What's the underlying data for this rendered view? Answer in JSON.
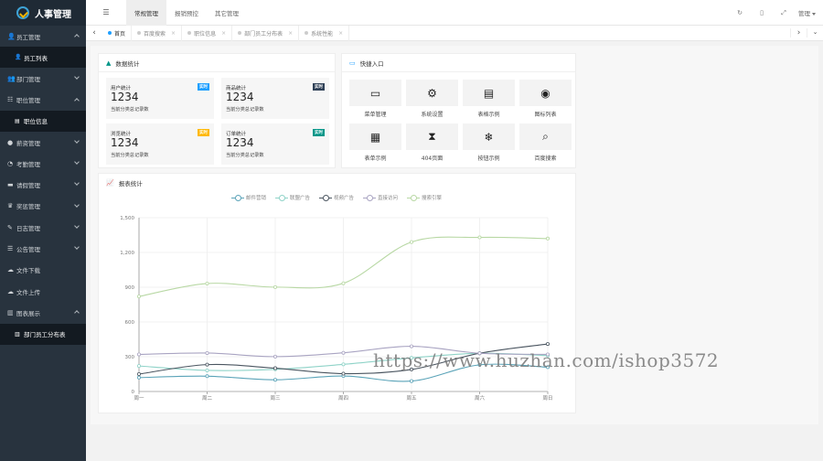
{
  "app": {
    "title": "人事管理"
  },
  "sidebar": {
    "items": [
      {
        "label": "员工管理",
        "icon": "user-icon",
        "glyph": "👤",
        "expanded": true,
        "children": [
          {
            "label": "员工列表",
            "glyph": "👤"
          }
        ]
      },
      {
        "label": "部门管理",
        "icon": "users-icon",
        "glyph": "👥",
        "expanded": false
      },
      {
        "label": "职位管理",
        "icon": "list-icon",
        "glyph": "☷",
        "expanded": true,
        "children": [
          {
            "label": "职位信息",
            "glyph": "▤"
          }
        ]
      },
      {
        "label": "薪资管理",
        "icon": "money-icon",
        "glyph": "●",
        "expanded": false
      },
      {
        "label": "考勤管理",
        "icon": "clock-icon",
        "glyph": "◔",
        "expanded": false
      },
      {
        "label": "请假管理",
        "icon": "bed-icon",
        "glyph": "▬",
        "expanded": false
      },
      {
        "label": "奖惩管理",
        "icon": "trophy-icon",
        "glyph": "♛",
        "expanded": false
      },
      {
        "label": "日志管理",
        "icon": "wrench-icon",
        "glyph": "✎",
        "expanded": false
      },
      {
        "label": "公告管理",
        "icon": "bars-icon",
        "glyph": "☰",
        "expanded": false
      },
      {
        "label": "文件下载",
        "icon": "cloud-download-icon",
        "glyph": "☁",
        "expanded": null
      },
      {
        "label": "文件上传",
        "icon": "cloud-upload-icon",
        "glyph": "☁",
        "expanded": null
      },
      {
        "label": "图表展示",
        "icon": "chart-icon",
        "glyph": "▥",
        "expanded": true,
        "children": [
          {
            "label": "部门员工分布表",
            "glyph": "▥"
          }
        ]
      }
    ]
  },
  "topbar": {
    "menu_toggle_glyph": "☰",
    "nav": [
      {
        "label": "常规管理",
        "active": true
      },
      {
        "label": "报销预控",
        "active": false
      },
      {
        "label": "其它管理",
        "active": false
      }
    ],
    "user_label": "管理"
  },
  "tabs": [
    {
      "label": "首页",
      "active": true,
      "closable": false
    },
    {
      "label": "百度搜索",
      "active": false,
      "closable": true
    },
    {
      "label": "职位信息",
      "active": false,
      "closable": true
    },
    {
      "label": "部门员工分布表",
      "active": false,
      "closable": true
    },
    {
      "label": "系统性能",
      "active": false,
      "closable": true
    }
  ],
  "stats_panel": {
    "title": "数据统计",
    "cards": [
      {
        "label": "用户统计",
        "value": "1234",
        "desc": "当前分类总记录数",
        "badge": "实时",
        "badge_color": "#1e9fff"
      },
      {
        "label": "商品统计",
        "value": "1234",
        "desc": "当前分类总记录数",
        "badge": "实时",
        "badge_color": "#2f4056"
      },
      {
        "label": "浏览统计",
        "value": "1234",
        "desc": "当前分类总记录数",
        "badge": "实时",
        "badge_color": "#ffb800"
      },
      {
        "label": "订单统计",
        "value": "1234",
        "desc": "当前分类总记录数",
        "badge": "实时",
        "badge_color": "#009688"
      }
    ]
  },
  "quick_panel": {
    "title": "快捷入口",
    "items": [
      {
        "label": "菜单管理",
        "icon": "window-icon",
        "glyph": "▭"
      },
      {
        "label": "系统设置",
        "icon": "gears-icon",
        "glyph": "⚙"
      },
      {
        "label": "表格示例",
        "icon": "file-icon",
        "glyph": "▤"
      },
      {
        "label": "图标列表",
        "icon": "dot-circle-icon",
        "glyph": "◉"
      },
      {
        "label": "表单示例",
        "icon": "calendar-icon",
        "glyph": "▦"
      },
      {
        "label": "404页面",
        "icon": "hourglass-icon",
        "glyph": "⧗"
      },
      {
        "label": "按钮示例",
        "icon": "snowflake-icon",
        "glyph": "❄"
      },
      {
        "label": "百度搜索",
        "icon": "search-icon",
        "glyph": "⌕"
      }
    ]
  },
  "report_panel": {
    "title": "报表统计"
  },
  "chart_data": {
    "type": "line",
    "categories": [
      "周一",
      "周二",
      "周三",
      "周四",
      "周五",
      "周六",
      "周日"
    ],
    "yticks": [
      "0",
      "300",
      "600",
      "900",
      "1,200",
      "1,500"
    ],
    "ylim": [
      0,
      1500
    ],
    "legend_position": "top-center",
    "series": [
      {
        "name": "邮件营销",
        "color": "#5aa3b8",
        "values": [
          120,
          132,
          101,
          134,
          90,
          230,
          210
        ]
      },
      {
        "name": "联盟广告",
        "color": "#8fd3c8",
        "values": [
          220,
          182,
          191,
          234,
          290,
          330,
          310
        ]
      },
      {
        "name": "视频广告",
        "color": "#4a5560",
        "values": [
          150,
          232,
          201,
          154,
          190,
          330,
          410
        ]
      },
      {
        "name": "直接访问",
        "color": "#a9a4c2",
        "values": [
          320,
          332,
          301,
          334,
          390,
          330,
          320
        ]
      },
      {
        "name": "搜索引擎",
        "color": "#b8d8a4",
        "values": [
          820,
          932,
          901,
          934,
          1290,
          1330,
          1320
        ]
      }
    ]
  },
  "watermark": "https://www.huzhan.com/ishop3572",
  "colors": {
    "sidebar_bg": "#28333e",
    "sidebar_active": "#131a21",
    "accent": "#1e9fff"
  }
}
